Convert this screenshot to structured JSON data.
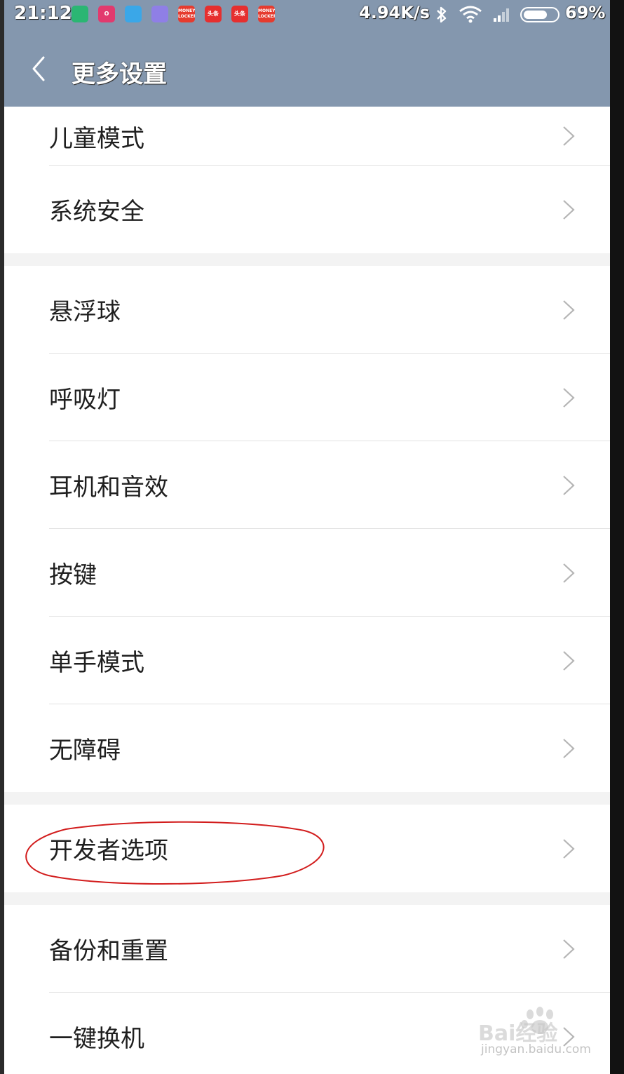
{
  "status_bar": {
    "time": "21:12",
    "net_speed": "4.94K/s",
    "battery": "69%",
    "battery_level": 0.69,
    "notification_icons": [
      {
        "name": "shield-app-icon",
        "color": "#2bb673",
        "text": ""
      },
      {
        "name": "o-app-icon",
        "color": "#e23a6e",
        "text": "O"
      },
      {
        "name": "browser-app-icon",
        "color": "#3aa7e8",
        "text": ""
      },
      {
        "name": "purple-app-icon",
        "color": "#8f7fe6",
        "text": ""
      },
      {
        "name": "money-locker-icon",
        "color": "#e63b2e",
        "text": "MONEY LOCKER"
      },
      {
        "name": "toutiao-icon",
        "color": "#e62f2f",
        "text": "头条"
      },
      {
        "name": "toutiao-icon-2",
        "color": "#e62f2f",
        "text": "头条"
      },
      {
        "name": "money-locker-icon-2",
        "color": "#e63b2e",
        "text": "MONEY LOCKER"
      }
    ]
  },
  "header": {
    "title": "更多设置"
  },
  "settings": {
    "group1": [
      "儿童模式",
      "系统安全"
    ],
    "group2": [
      "悬浮球",
      "呼吸灯",
      "耳机和音效",
      "按键",
      "单手模式",
      "无障碍"
    ],
    "group3": [
      "开发者选项"
    ],
    "group4": [
      "备份和重置",
      "一键换机"
    ]
  },
  "colors": {
    "header_bg": "#8497ae",
    "annotation": "#d21d1d"
  },
  "watermark": {
    "brand": "Bai经验",
    "url": "jingyan.baidu.com"
  }
}
